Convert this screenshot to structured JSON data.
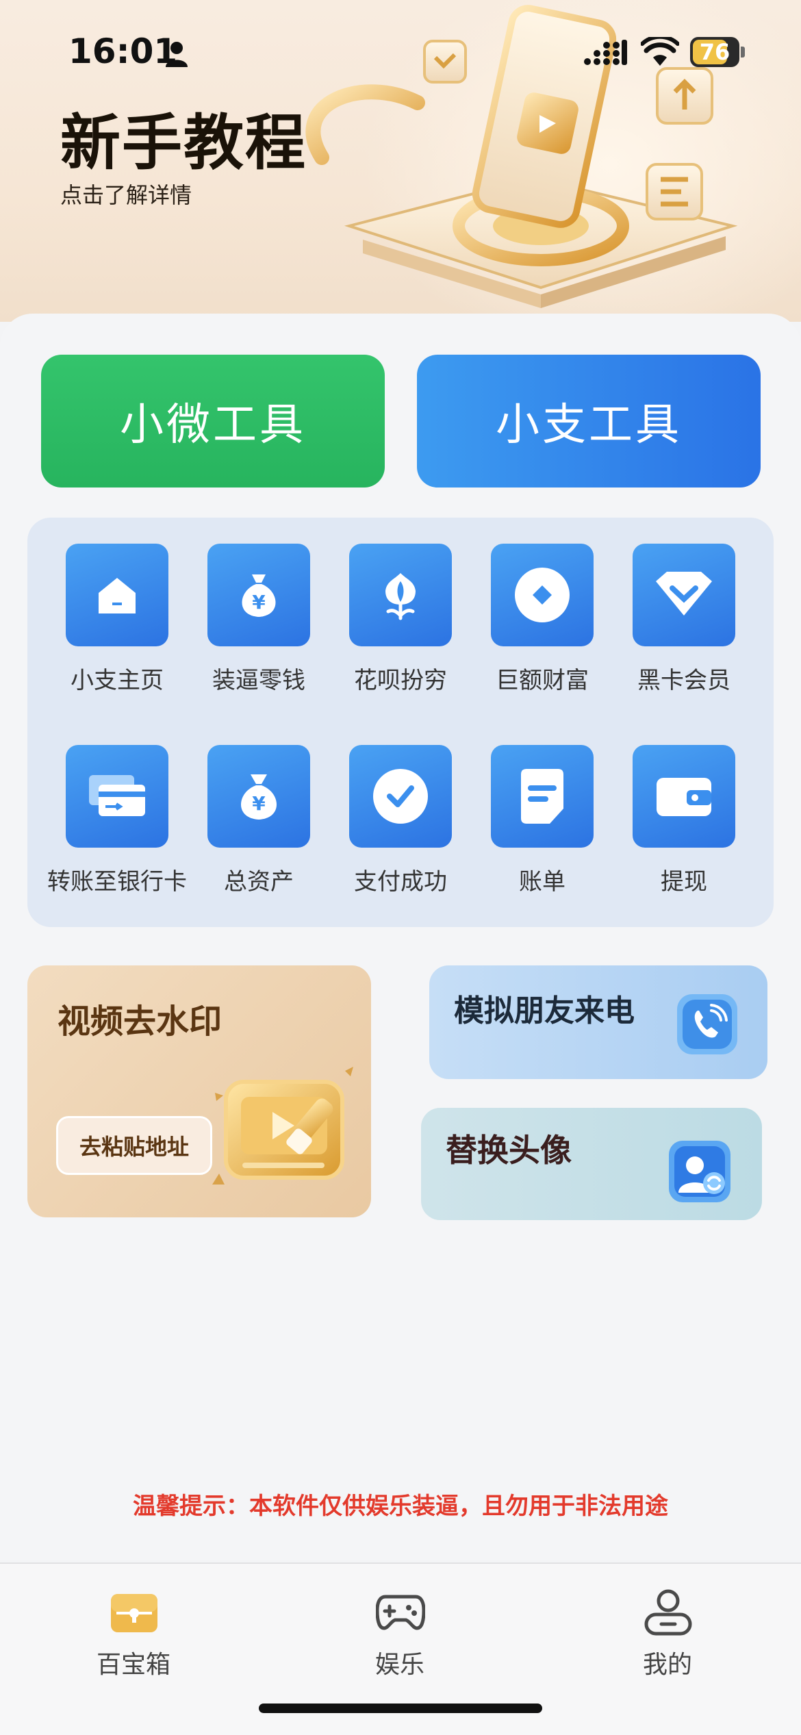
{
  "status_bar": {
    "time": "16:01",
    "battery": "76"
  },
  "hero": {
    "title": "新手教程",
    "subtitle": "点击了解详情"
  },
  "tools": {
    "wechat_label": "小微工具",
    "alipay_label": "小支工具"
  },
  "grid": {
    "items": [
      {
        "label": "小支主页",
        "icon": "home-icon"
      },
      {
        "label": "装逼零钱",
        "icon": "money-bag-yen-icon"
      },
      {
        "label": "花呗扮穷",
        "icon": "flower-icon"
      },
      {
        "label": "巨额财富",
        "icon": "diamond-circle-icon"
      },
      {
        "label": "黑卡会员",
        "icon": "gem-icon"
      },
      {
        "label": "转账至银行卡",
        "icon": "bank-card-icon"
      },
      {
        "label": "总资产",
        "icon": "money-bag-icon"
      },
      {
        "label": "支付成功",
        "icon": "check-circle-icon"
      },
      {
        "label": "账单",
        "icon": "bill-icon"
      },
      {
        "label": "提现",
        "icon": "wallet-icon"
      }
    ]
  },
  "cards": {
    "video": {
      "title": "视频去水印",
      "button": "去粘贴地址"
    },
    "call": {
      "title": "模拟朋友来电"
    },
    "avatar": {
      "title": "替换头像"
    }
  },
  "notice": "温馨提示：本软件仅供娱乐装逼，且勿用于非法用途",
  "tabbar": {
    "items": [
      {
        "label": "百宝箱",
        "icon": "treasure-box-icon",
        "active": true
      },
      {
        "label": "娱乐",
        "icon": "gamepad-icon",
        "active": false
      },
      {
        "label": "我的",
        "icon": "user-icon",
        "active": false
      }
    ]
  },
  "colors": {
    "wechat_green": "#2bb964",
    "alipay_blue": "#2f80ea",
    "notice_red": "#e33a2c",
    "gold": "#e8b64f"
  }
}
